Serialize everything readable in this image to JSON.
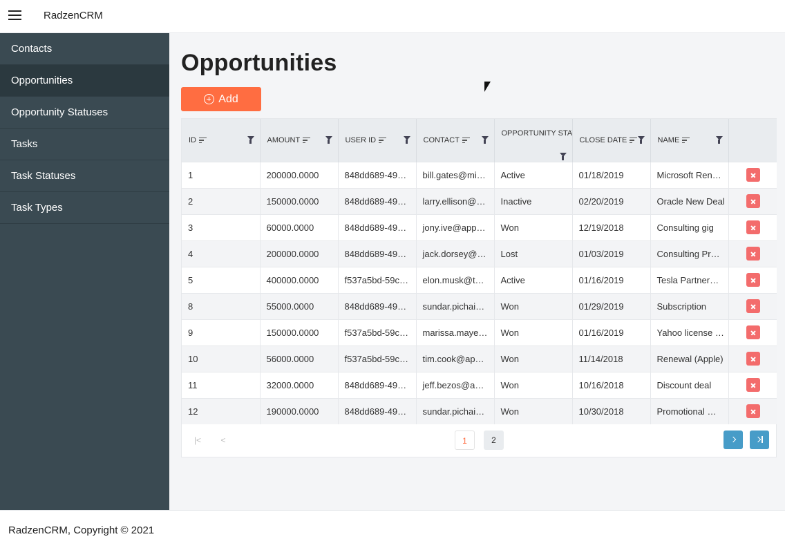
{
  "header": {
    "brand": "RadzenCRM"
  },
  "sidebar": {
    "items": [
      {
        "label": "Contacts"
      },
      {
        "label": "Opportunities"
      },
      {
        "label": "Opportunity Statuses"
      },
      {
        "label": "Tasks"
      },
      {
        "label": "Task Statuses"
      },
      {
        "label": "Task Types"
      }
    ],
    "active": "Opportunities"
  },
  "main": {
    "title": "Opportunities",
    "add_label": "Add"
  },
  "grid": {
    "columns": [
      "ID",
      "AMOUNT",
      "USER ID",
      "CONTACT",
      "OPPORTUNITY STATUS",
      "CLOSE DATE",
      "NAME"
    ],
    "rows": [
      [
        "1",
        "200000.0000",
        "848dd689-49…",
        "bill.gates@mi…",
        "Active",
        "01/18/2019",
        "Microsoft Ren…"
      ],
      [
        "2",
        "150000.0000",
        "848dd689-49…",
        "larry.ellison@…",
        "Inactive",
        "02/20/2019",
        "Oracle New Deal"
      ],
      [
        "3",
        "60000.0000",
        "848dd689-49…",
        "jony.ive@app…",
        "Won",
        "12/19/2018",
        "Consulting gig"
      ],
      [
        "4",
        "200000.0000",
        "848dd689-49…",
        "jack.dorsey@…",
        "Lost",
        "01/03/2019",
        "Consulting Pr…"
      ],
      [
        "5",
        "400000.0000",
        "f537a5bd-59c…",
        "elon.musk@t…",
        "Active",
        "01/16/2019",
        "Tesla Partner…"
      ],
      [
        "8",
        "55000.0000",
        "848dd689-49…",
        "sundar.pichai…",
        "Won",
        "01/29/2019",
        "Subscription"
      ],
      [
        "9",
        "150000.0000",
        "f537a5bd-59c…",
        "marissa.maye…",
        "Won",
        "01/16/2019",
        "Yahoo license …"
      ],
      [
        "10",
        "56000.0000",
        "f537a5bd-59c…",
        "tim.cook@ap…",
        "Won",
        "11/14/2018",
        "Renewal (Apple)"
      ],
      [
        "11",
        "32000.0000",
        "848dd689-49…",
        "jeff.bezos@a…",
        "Won",
        "10/16/2018",
        "Discount deal"
      ],
      [
        "12",
        "190000.0000",
        "848dd689-49…",
        "sundar.pichai…",
        "Won",
        "10/30/2018",
        "Promotional …"
      ]
    ]
  },
  "pager": {
    "pages": [
      "1",
      "2"
    ],
    "current": "1"
  },
  "footer": {
    "text": "RadzenCRM, Copyright © 2021"
  },
  "colors": {
    "accent": "#ff6d41",
    "sidebar": "#3a4a52",
    "pager_button": "#479cc8",
    "delete": "#f36c6c"
  },
  "icons": [
    "menu-icon",
    "add-circle-icon",
    "sort-icon",
    "filter-icon",
    "close-icon",
    "first-page-icon",
    "prev-page-icon",
    "next-page-icon",
    "last-page-icon"
  ]
}
